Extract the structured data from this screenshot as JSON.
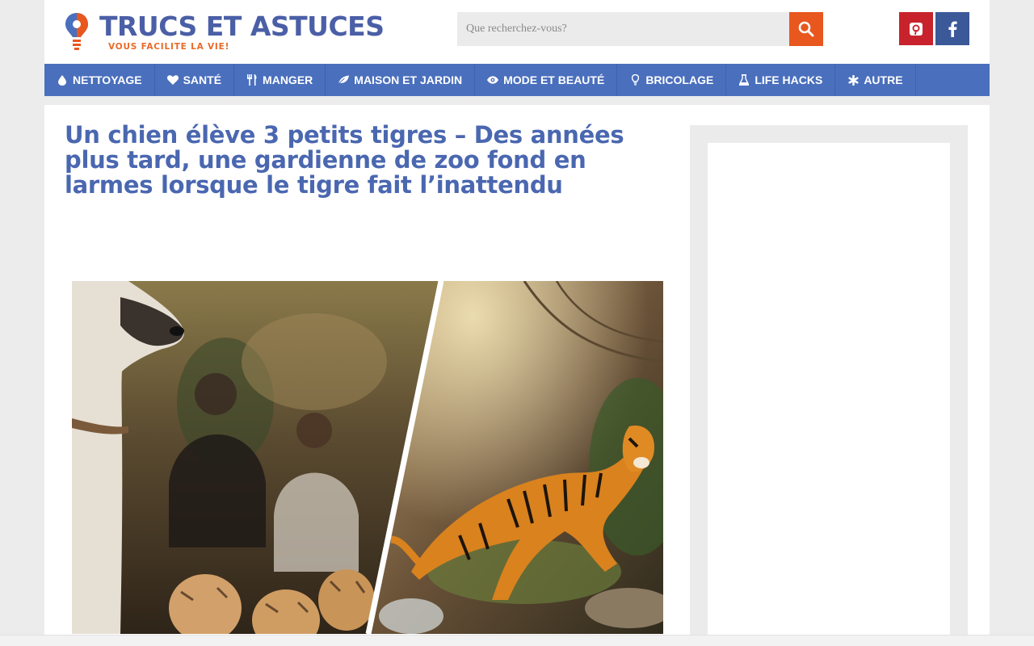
{
  "header": {
    "logo_title": "TRUCS ET ASTUCES",
    "logo_tagline": "VOUS FACILITE LA VIE!",
    "search_placeholder": "Que recherchez-vous?",
    "search_icon": "search-icon",
    "social": [
      {
        "name": "pinterest",
        "icon": "pinterest-icon",
        "color": "#c8232c"
      },
      {
        "name": "facebook",
        "icon": "facebook-icon",
        "color": "#3b5998"
      }
    ]
  },
  "nav": {
    "items": [
      {
        "label": "NETTOYAGE",
        "icon": "drop-icon"
      },
      {
        "label": "SANTÉ",
        "icon": "heart-icon"
      },
      {
        "label": "MANGER",
        "icon": "utensils-icon"
      },
      {
        "label": "MAISON ET JARDIN",
        "icon": "leaf-icon"
      },
      {
        "label": "MODE ET BEAUTÉ",
        "icon": "eye-icon"
      },
      {
        "label": "BRICOLAGE",
        "icon": "lightbulb-icon"
      },
      {
        "label": "LIFE HACKS",
        "icon": "flask-icon"
      },
      {
        "label": "AUTRE",
        "icon": "asterisk-icon"
      }
    ]
  },
  "article": {
    "title": "Un chien élève 3 petits tigres – Des années plus tard, une gardienne de zoo fond en larmes lorsque le tigre fait l’inattendu"
  },
  "colors": {
    "brand_blue": "#4a6fbd",
    "title_blue": "#4a67b0",
    "accent_orange": "#e8571e",
    "page_bg": "#ececec"
  }
}
